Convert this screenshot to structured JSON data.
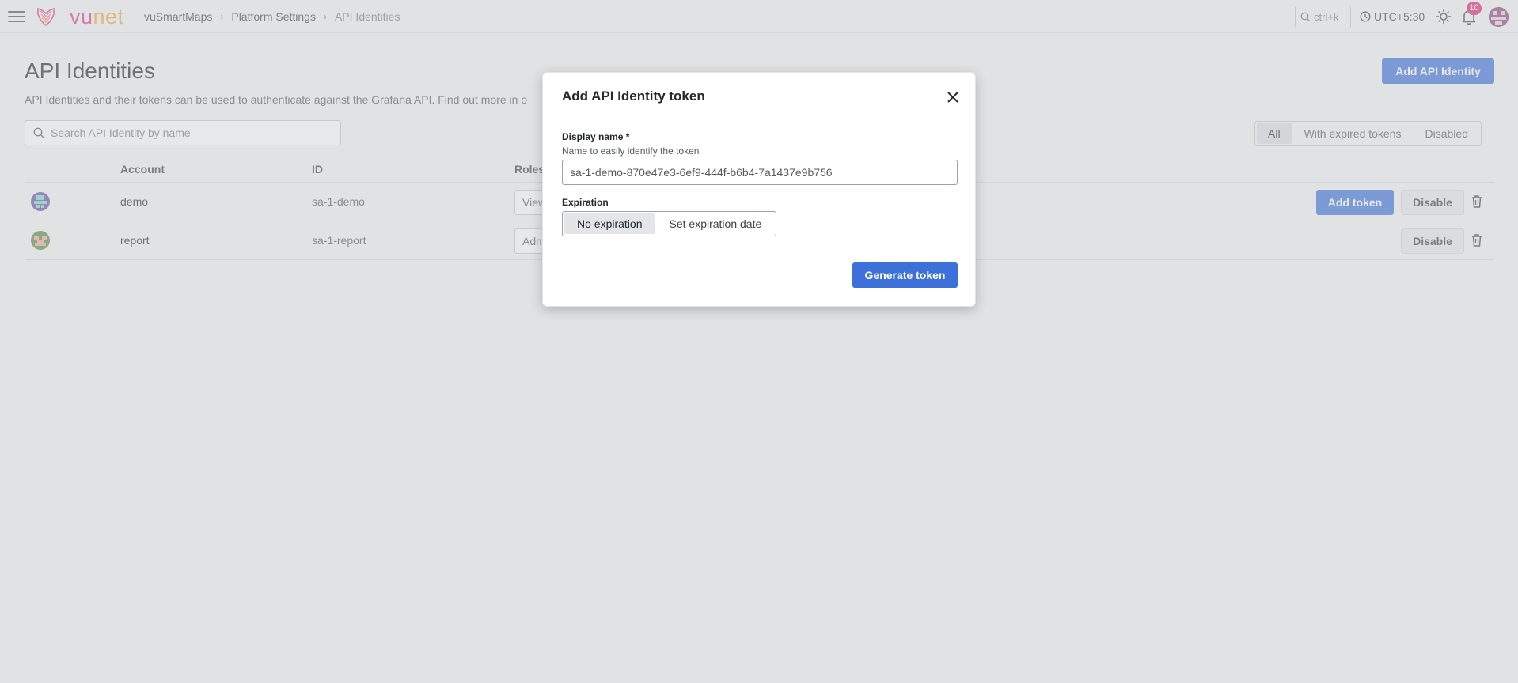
{
  "header": {
    "logo": {
      "vu": "vu",
      "net": "net"
    },
    "breadcrumb": [
      "vuSmartMaps",
      "Platform Settings",
      "API Identities"
    ],
    "search_shortcut": "ctrl+k",
    "timezone": "UTC+5:30",
    "notification_count": "10",
    "icons": [
      "menu-icon",
      "search-icon",
      "clock-icon",
      "sun-icon",
      "bell-icon",
      "avatar"
    ]
  },
  "page": {
    "title": "API Identities",
    "description": "API Identities and their tokens can be used to authenticate against the Grafana API. Find out more in o",
    "add_button": "Add API Identity",
    "search_placeholder": "Search API Identity by name",
    "filters": [
      "All",
      "With expired tokens",
      "Disabled"
    ],
    "active_filter": "All"
  },
  "table": {
    "columns": [
      "Account",
      "ID",
      "Roles"
    ],
    "rows": [
      {
        "account": "demo",
        "id": "sa-1-demo",
        "role": "View",
        "add_token": "Add token",
        "disable": "Disable"
      },
      {
        "account": "report",
        "id": "sa-1-report",
        "role": "Adm",
        "disable": "Disable"
      }
    ]
  },
  "modal": {
    "title": "Add API Identity token",
    "display_name_label": "Display name *",
    "display_name_desc": "Name to easily identify the token",
    "display_name_value": "sa-1-demo-870e47e3-6ef9-444f-b6b4-7a1437e9b756",
    "expiration_label": "Expiration",
    "expiration_options": [
      "No expiration",
      "Set expiration date"
    ],
    "selected_expiration": "No expiration",
    "generate_button": "Generate token"
  },
  "colors": {
    "primary": "#3d71d9",
    "badge": "#e0226e",
    "logo_vu": "#e23b8a",
    "logo_net": "#f2a83a"
  }
}
